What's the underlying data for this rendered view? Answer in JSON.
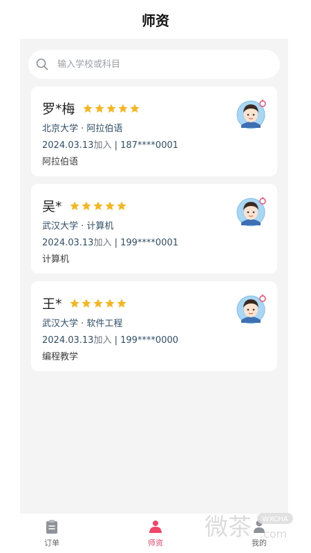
{
  "header": {
    "title": "师资"
  },
  "search": {
    "placeholder": "输入学校或科目"
  },
  "teachers": [
    {
      "name": "罗*梅",
      "rating": 5,
      "school_line": "北京大学 · 阿拉伯语",
      "join_date": "2024.03.13",
      "join_label": "加入",
      "separator": " | ",
      "phone": "187****0001",
      "subject": "阿拉伯语"
    },
    {
      "name": "吴*",
      "rating": 5,
      "school_line": "武汉大学 · 计算机",
      "join_date": "2024.03.13",
      "join_label": "加入",
      "separator": " | ",
      "phone": "199****0001",
      "subject": "计算机"
    },
    {
      "name": "王*",
      "rating": 5,
      "school_line": "武汉大学 · 软件工程",
      "join_date": "2024.03.13",
      "join_label": "加入",
      "separator": " | ",
      "phone": "199****0000",
      "subject": "编程教学"
    }
  ],
  "tabbar": {
    "items": [
      {
        "label": "订单",
        "icon": "clipboard-icon",
        "active": false
      },
      {
        "label": "师资",
        "icon": "teacher-icon",
        "active": true
      },
      {
        "label": "我的",
        "icon": "person-icon",
        "active": false
      }
    ]
  },
  "watermark": {
    "text": "微茶",
    "badge": "WXCHA",
    "domain": ".com"
  },
  "colors": {
    "accent": "#f2456a",
    "star": "#f5b623",
    "background": "#f4f4f5",
    "text_blue": "#2f4f68"
  }
}
